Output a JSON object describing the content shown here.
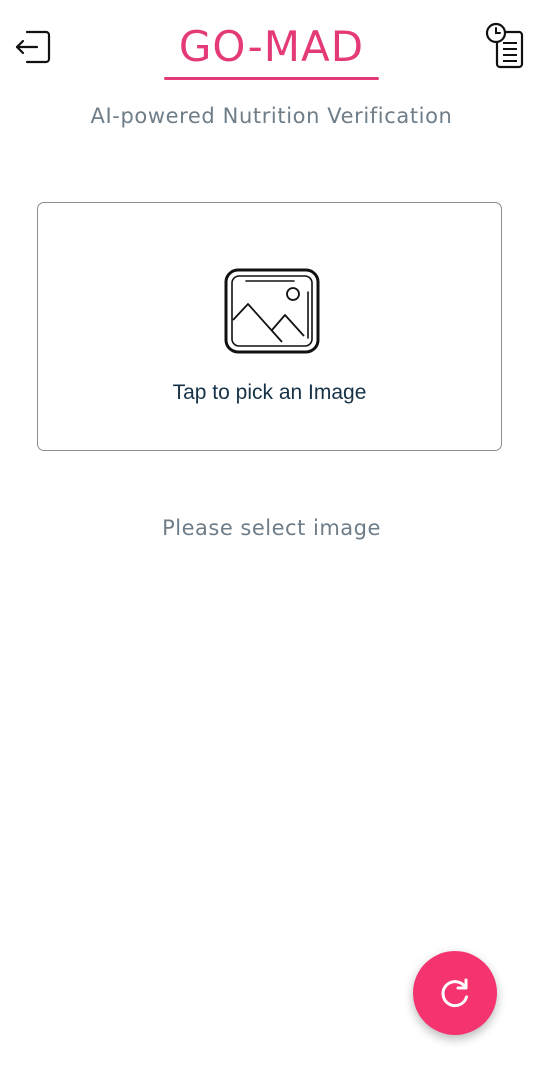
{
  "header": {
    "logo_text": "GO-MAD",
    "subtitle": "AI-powered Nutrition Verification",
    "logout_icon": "logout-icon",
    "history_icon": "history-icon"
  },
  "image_picker": {
    "label": "Tap to pick an Image",
    "icon": "image-placeholder-icon"
  },
  "status_text": "Please select image",
  "fab": {
    "icon": "refresh-icon"
  },
  "colors": {
    "brand": "#e53a78",
    "fab": "#f5336e",
    "muted_text": "#6e7d88",
    "label_text": "#163247"
  }
}
